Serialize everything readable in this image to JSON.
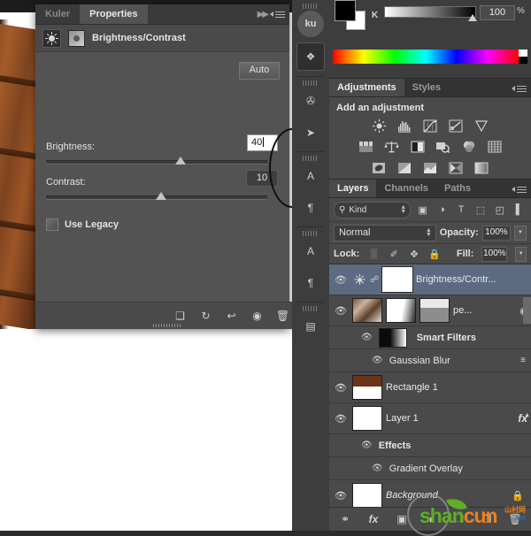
{
  "canvas": {
    "name": "document-canvas"
  },
  "properties_panel": {
    "tabs": [
      {
        "label": "Kuler",
        "active": false
      },
      {
        "label": "Properties",
        "active": true
      }
    ],
    "collapse_icon": "▶▶",
    "title": "Brightness/Contrast",
    "auto_label": "Auto",
    "brightness_label": "Brightness:",
    "brightness_value": "40",
    "contrast_label": "Contrast:",
    "contrast_value": "10",
    "use_legacy_label": "Use Legacy",
    "footer_icons": [
      {
        "name": "clip-to-layer-icon",
        "glyph": "❑"
      },
      {
        "name": "preview-previous-state-icon",
        "glyph": "↻"
      },
      {
        "name": "reset-icon",
        "glyph": "↩"
      },
      {
        "name": "toggle-visibility-icon",
        "glyph": "◉"
      },
      {
        "name": "delete-icon",
        "glyph": "🗑"
      }
    ]
  },
  "dock": {
    "items": [
      {
        "name": "kuler",
        "label": "ku",
        "selected": false
      },
      {
        "name": "adjustments",
        "label": "❖",
        "selected": true
      },
      {
        "name": "brushes",
        "label": "✇",
        "selected": false
      },
      {
        "name": "brush-presets",
        "label": "➤",
        "selected": false
      },
      {
        "name": "character",
        "label": "A",
        "selected": false
      },
      {
        "name": "paragraph",
        "label": "¶",
        "selected": false
      },
      {
        "name": "character-styles",
        "label": "A",
        "selected": false
      },
      {
        "name": "paragraph-styles",
        "label": "¶",
        "selected": false
      },
      {
        "name": "histogram",
        "label": "▤",
        "selected": false
      }
    ]
  },
  "color_panel": {
    "channel_label": "K",
    "value": "100",
    "unit": "%"
  },
  "adjustments_panel": {
    "tabs": [
      {
        "label": "Adjustments",
        "active": true
      },
      {
        "label": "Styles",
        "active": false
      }
    ],
    "title": "Add an adjustment",
    "rows": [
      [
        {
          "name": "brightness-contrast-icon"
        },
        {
          "name": "levels-icon"
        },
        {
          "name": "curves-icon"
        },
        {
          "name": "exposure-icon"
        },
        {
          "name": "vibrance-icon"
        }
      ],
      [
        {
          "name": "hue-saturation-icon"
        },
        {
          "name": "color-balance-icon"
        },
        {
          "name": "black-white-icon"
        },
        {
          "name": "photo-filter-icon"
        },
        {
          "name": "channel-mixer-icon"
        },
        {
          "name": "color-lookup-icon"
        }
      ],
      [
        {
          "name": "invert-icon"
        },
        {
          "name": "posterize-icon"
        },
        {
          "name": "threshold-icon"
        },
        {
          "name": "selective-color-icon"
        },
        {
          "name": "gradient-map-icon"
        }
      ]
    ]
  },
  "layers_panel": {
    "tabs": [
      {
        "label": "Layers",
        "active": true
      },
      {
        "label": "Channels",
        "active": false
      },
      {
        "label": "Paths",
        "active": false
      }
    ],
    "filter_label": "Kind",
    "filter_icons": [
      {
        "name": "filter-pixel-icon",
        "glyph": "▣"
      },
      {
        "name": "filter-adjustment-icon",
        "glyph": "◑"
      },
      {
        "name": "filter-type-icon",
        "glyph": "T"
      },
      {
        "name": "filter-shape-icon",
        "glyph": "⬚"
      },
      {
        "name": "filter-smart-object-icon",
        "glyph": "◰"
      }
    ],
    "blend_mode": "Normal",
    "opacity_label": "Opacity:",
    "opacity_value": "100%",
    "lock_label": "Lock:",
    "lock_icons": [
      {
        "name": "lock-transparent-pixels-icon",
        "glyph": "░"
      },
      {
        "name": "lock-image-pixels-icon",
        "glyph": "✐"
      },
      {
        "name": "lock-position-icon",
        "glyph": "✥"
      },
      {
        "name": "lock-all-icon",
        "glyph": "🔒"
      }
    ],
    "fill_label": "Fill:",
    "fill_value": "100%",
    "layers": [
      {
        "name": "Brightness/Contr...",
        "type": "adjustment",
        "selected": true,
        "visible": true,
        "linked": true
      },
      {
        "name": "pe...",
        "type": "smart-object",
        "selected": false,
        "visible": true,
        "children": [
          {
            "name": "Smart Filters",
            "type": "smart-filters",
            "visible": true
          },
          {
            "name": "Gaussian Blur",
            "type": "filter",
            "visible": true
          }
        ]
      },
      {
        "name": "Rectangle 1",
        "type": "shape",
        "selected": false,
        "visible": true
      },
      {
        "name": "Layer 1",
        "type": "pixel",
        "selected": false,
        "visible": true,
        "fx": "fx",
        "children": [
          {
            "name": "Effects",
            "type": "effects-group",
            "visible": true
          },
          {
            "name": "Gradient Overlay",
            "type": "effect",
            "visible": true
          }
        ]
      },
      {
        "name": "Background",
        "type": "background",
        "selected": false,
        "visible": true,
        "locked": true
      }
    ],
    "footer_icons": [
      {
        "name": "link-layers-icon",
        "glyph": "⚭"
      },
      {
        "name": "add-layer-style-icon",
        "glyph": "fx"
      },
      {
        "name": "add-layer-mask-icon",
        "glyph": "▣"
      },
      {
        "name": "new-fill-adjustment-icon",
        "glyph": "◑"
      },
      {
        "name": "new-group-icon",
        "glyph": "🗀"
      },
      {
        "name": "new-layer-icon",
        "glyph": "❐"
      },
      {
        "name": "delete-layer-icon",
        "glyph": "🗑"
      }
    ]
  },
  "watermark": {
    "part_green": "shan",
    "part_orange": "cun",
    "suffix_top": "山村网",
    "suffix_bottom": ".net"
  },
  "colors": {
    "panel_bg": "#535353",
    "dark_bg": "#3d3d3d",
    "mid_bg": "#4a4a4a",
    "selection": "#5d6b82",
    "text": "#e6e6e6"
  }
}
